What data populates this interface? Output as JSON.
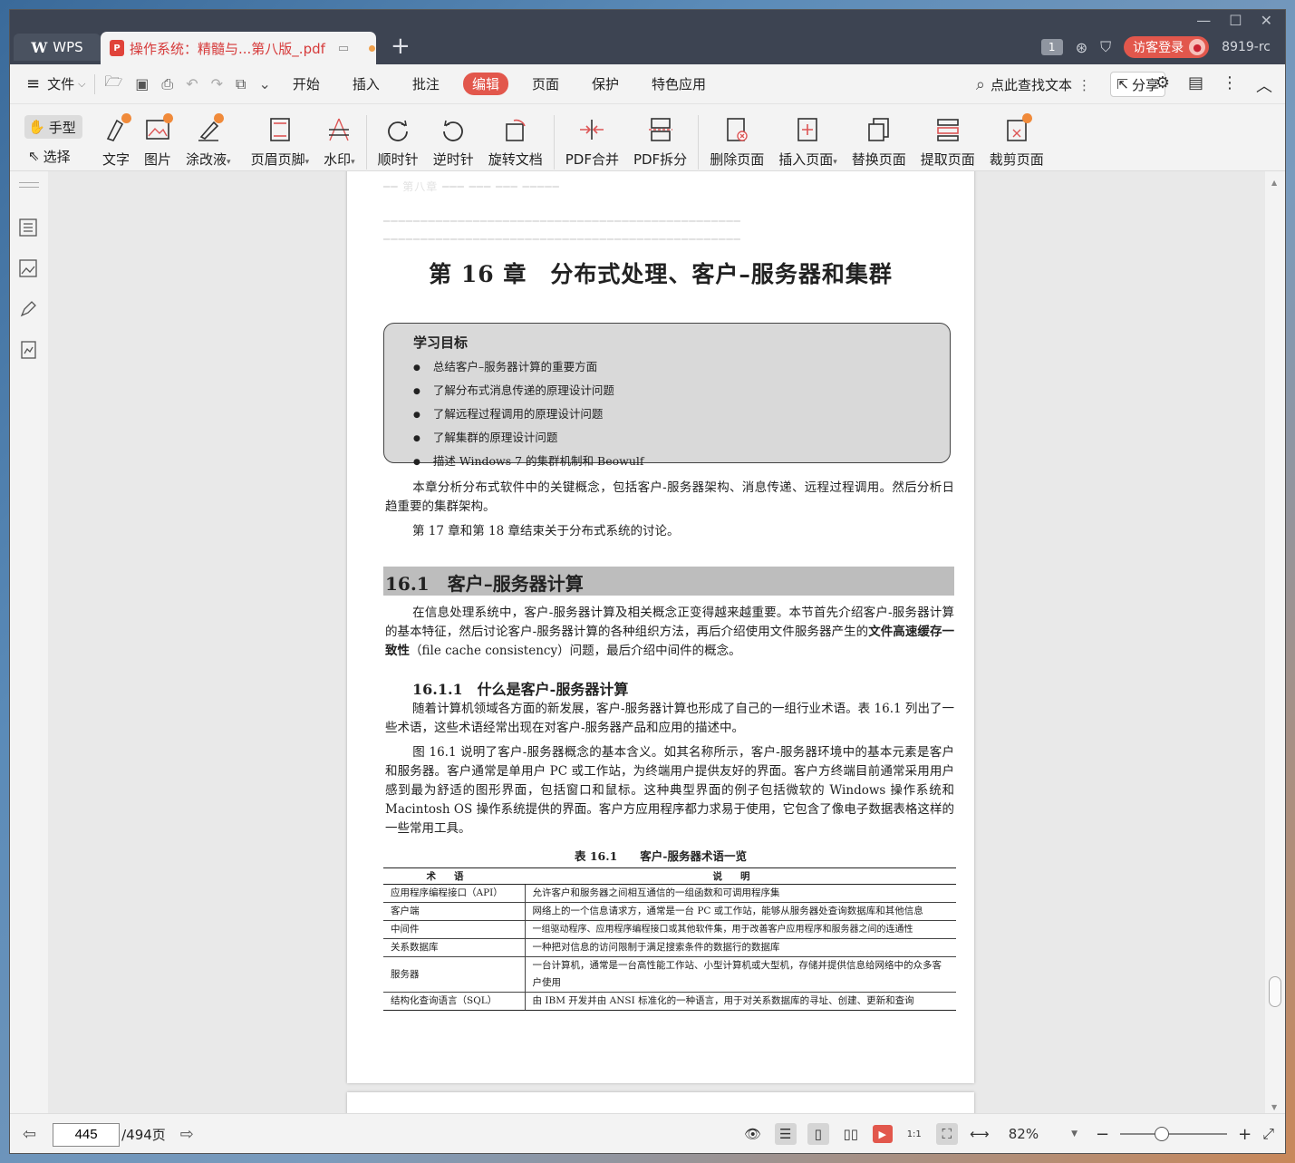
{
  "titlebar": {
    "wps_tab": "WPS",
    "doc_tab": "操作系统：精髓与...第八版_.pdf",
    "pdf_badge": "P",
    "badge_count": "1",
    "guest_login": "访客登录",
    "user_code": "8919-rc"
  },
  "menubar": {
    "file": "文件",
    "items": [
      "开始",
      "插入",
      "批注",
      "编辑",
      "页面",
      "保护",
      "特色应用"
    ],
    "active_item": "编辑",
    "search": "点此查找文本",
    "share": "分享"
  },
  "toolbar": {
    "hand": "手型",
    "select": "选择",
    "tools": [
      "文字",
      "图片",
      "涂改液",
      "页眉页脚",
      "水印",
      "顺时针",
      "逆时针",
      "旋转文档",
      "PDF合并",
      "PDF拆分",
      "删除页面",
      "插入页面",
      "替换页面",
      "提取页面",
      "裁剪页面"
    ]
  },
  "document": {
    "chapter_title": "第 16 章　分布式处理、客户–服务器和集群",
    "goals_title": "学习目标",
    "goals": [
      "总结客户–服务器计算的重要方面",
      "了解分布式消息传递的原理设计问题",
      "了解远程过程调用的原理设计问题",
      "了解集群的原理设计问题",
      "描述 Windows 7 的集群机制和 Beowulf"
    ],
    "intro_p1": "本章分析分布式软件中的关键概念，包括客户-服务器架构、消息传递、远程过程调用。然后分析日趋重要的集群架构。",
    "intro_p2": "第 17 章和第 18 章结束关于分布式系统的讨论。",
    "section_title": "16.1　客户–服务器计算",
    "section_p_a": "在信息处理系统中，客户-服务器计算及相关概念正变得越来越重要。本节首先介绍客户-服务器计算的基本特征，然后讨论客户-服务器计算的各种组织方法，再后介绍使用文件服务器产生的",
    "section_p_bold": "文件高速缓存一致性",
    "section_p_b": "（file cache consistency）问题，最后介绍中间件的概念。",
    "subsection_title": "16.1.1　什么是客户-服务器计算",
    "sub_p1": "随着计算机领域各方面的新发展，客户-服务器计算也形成了自己的一组行业术语。表 16.1 列出了一些术语，这些术语经常出现在对客户-服务器产品和应用的描述中。",
    "sub_p2": "图 16.1 说明了客户-服务器概念的基本含义。如其名称所示，客户-服务器环境中的基本元素是客户和服务器。客户通常是单用户 PC 或工作站，为终端用户提供友好的界面。客户方终端目前通常采用用户感到最为舒适的图形界面，包括窗口和鼠标。这种典型界面的例子包括微软的 Windows 操作系统和 Macintosh OS 操作系统提供的界面。客户方应用程序都力求易于使用，它包含了像电子数据表格这样的一些常用工具。",
    "table_caption": "表 16.1　　客户-服务器术语一览",
    "table_headers": [
      "术语",
      "说明"
    ],
    "table_rows": [
      [
        "应用程序编程接口（API）",
        "允许客户和服务器之间相互通信的一组函数和可调用程序集"
      ],
      [
        "客户端",
        "网络上的一个信息请求方，通常是一台 PC 或工作站，能够从服务器处查询数据库和其他信息"
      ],
      [
        "中间件",
        "一组驱动程序、应用程序编程接口或其他软件集，用于改善客户应用程序和服务器之间的连通性"
      ],
      [
        "关系数据库",
        "一种把对信息的访问限制于满足搜索条件的数据行的数据库"
      ],
      [
        "服务器",
        "一台计算机，通常是一台高性能工作站、小型计算机或大型机，存储并提供信息给网络中的众多客户使用"
      ],
      [
        "结构化查询语言（SQL）",
        "由 IBM 开发并由 ANSI 标准化的一种语言，用于对关系数据库的寻址、创建、更新和查询"
      ]
    ]
  },
  "statusbar": {
    "current_page": "445",
    "total_pages": "/494页",
    "zoom": "82%"
  },
  "colors": {
    "accent": "#e2574c",
    "titlebar": "#3d4452"
  }
}
